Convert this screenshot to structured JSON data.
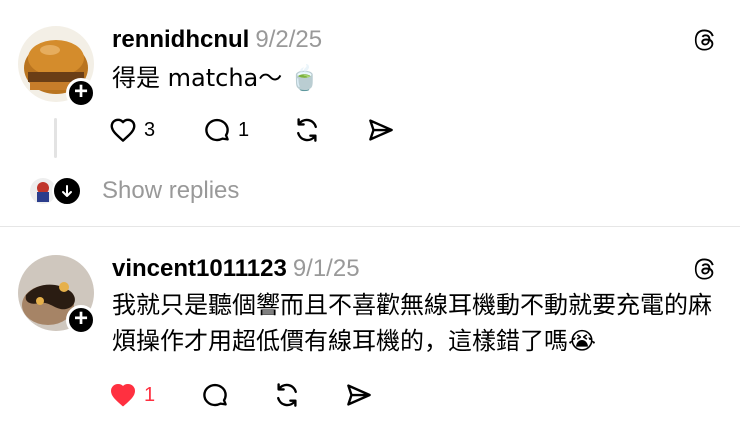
{
  "posts": [
    {
      "username": "rennidhcnul",
      "date": "9/2/25",
      "text": "得是 matcha～ 🍵",
      "likes": "3",
      "comments": "1",
      "liked": false
    },
    {
      "username": "vincent1011123",
      "date": "9/1/25",
      "text": "我就只是聽個響而且不喜歡無線耳機動不動就要充電的麻煩操作才用超低價有線耳機的，這樣錯了嗎😭",
      "likes": "1",
      "comments": "",
      "liked": true
    }
  ],
  "replies": {
    "label": "Show replies"
  },
  "colors": {
    "like_active": "#ff3040",
    "secondary_text": "#999999"
  }
}
